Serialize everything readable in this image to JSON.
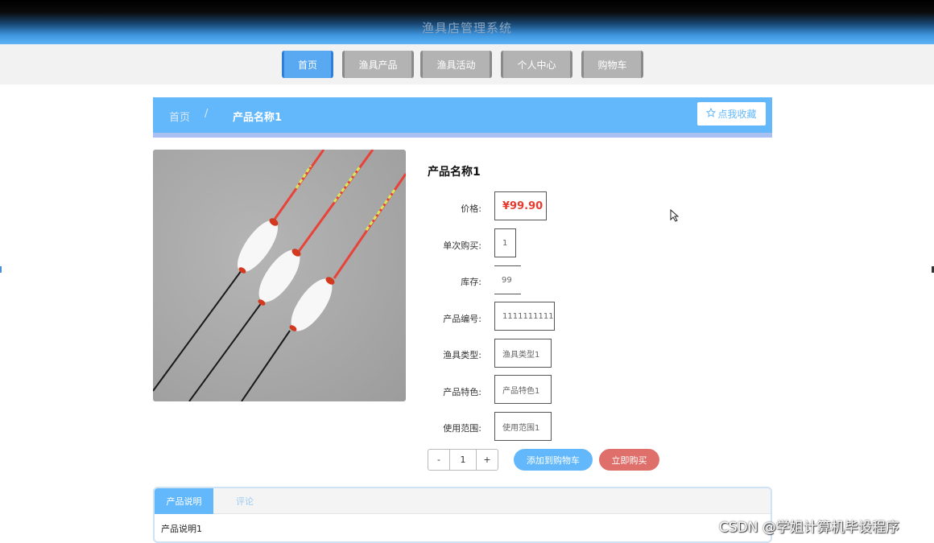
{
  "header": {
    "title": "渔具店管理系统"
  },
  "nav": [
    {
      "label": "首页",
      "active": true
    },
    {
      "label": "渔具产品",
      "active": false
    },
    {
      "label": "渔具活动",
      "active": false
    },
    {
      "label": "个人中心",
      "active": false
    },
    {
      "label": "购物车",
      "active": false
    }
  ],
  "breadcrumb": {
    "home": "首页",
    "separator": "/",
    "current": "产品名称1",
    "favorite_label": "点我收藏",
    "favorite_icon": "star-outline-icon"
  },
  "product": {
    "name": "产品名称1",
    "fields": [
      {
        "label": "价格:",
        "value": "¥99.90"
      },
      {
        "label": "单次购买:",
        "value": "1"
      },
      {
        "label": "库存:",
        "value": "99"
      },
      {
        "label": "产品编号:",
        "value": "1111111111"
      },
      {
        "label": "渔具类型:",
        "value": "渔具类型1"
      },
      {
        "label": "产品特色:",
        "value": "产品特色1"
      },
      {
        "label": "使用范围:",
        "value": "使用范围1"
      }
    ]
  },
  "purchase": {
    "minus": "-",
    "quantity": "1",
    "plus": "+",
    "add_to_cart": "添加到购物车",
    "buy_now": "立即购买"
  },
  "tabs": [
    {
      "label": "产品说明"
    },
    {
      "label": "评论"
    }
  ],
  "tab_content": "产品说明1",
  "watermark": "CSDN @学姐计算机毕设程序",
  "colors": {
    "accent": "#63b8fb",
    "price": "#e63c2f",
    "buy": "#df6f6a",
    "nav_inactive": "#b3b3b3"
  }
}
